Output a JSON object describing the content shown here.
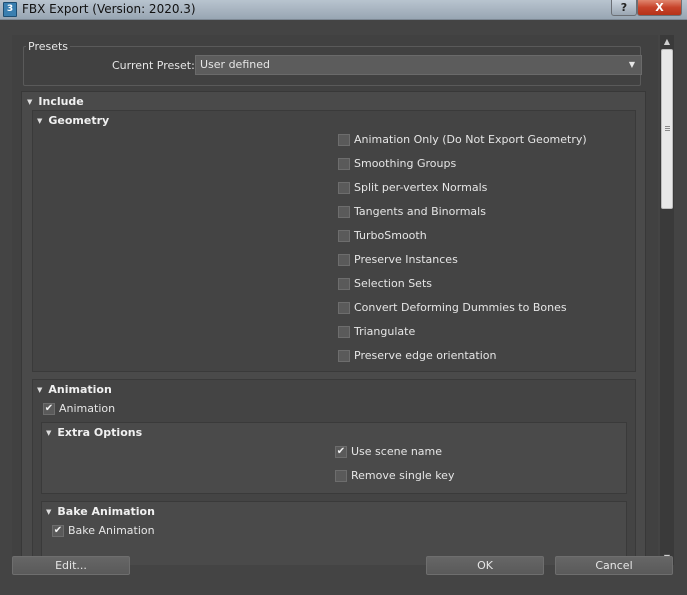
{
  "window": {
    "title": "FBX Export (Version: 2020.3)",
    "app_icon_text": "3",
    "help_label": "?",
    "close_label": "X"
  },
  "presets": {
    "group_label": "Presets",
    "current_preset_label": "Current Preset:",
    "current_preset_value": "User defined"
  },
  "include": {
    "label": "Include",
    "geometry": {
      "label": "Geometry",
      "options": [
        {
          "label": "Animation Only (Do Not Export Geometry)",
          "checked": false
        },
        {
          "label": "Smoothing Groups",
          "checked": false
        },
        {
          "label": "Split per-vertex Normals",
          "checked": false
        },
        {
          "label": "Tangents and Binormals",
          "checked": false
        },
        {
          "label": "TurboSmooth",
          "checked": false
        },
        {
          "label": "Preserve Instances",
          "checked": false
        },
        {
          "label": "Selection Sets",
          "checked": false
        },
        {
          "label": "Convert Deforming Dummies to Bones",
          "checked": false
        },
        {
          "label": "Triangulate",
          "checked": false
        },
        {
          "label": "Preserve edge orientation",
          "checked": false
        }
      ]
    },
    "animation": {
      "label": "Animation",
      "animation_checkbox": {
        "label": "Animation",
        "checked": true
      },
      "extra_options": {
        "label": "Extra Options",
        "options": [
          {
            "label": "Use scene name",
            "checked": true
          },
          {
            "label": "Remove single key",
            "checked": false
          }
        ]
      },
      "bake_animation": {
        "label": "Bake Animation",
        "checkbox": {
          "label": "Bake Animation",
          "checked": true
        }
      }
    }
  },
  "footer": {
    "edit_label": "Edit...",
    "ok_label": "OK",
    "cancel_label": "Cancel"
  },
  "check_glyph": "✔"
}
